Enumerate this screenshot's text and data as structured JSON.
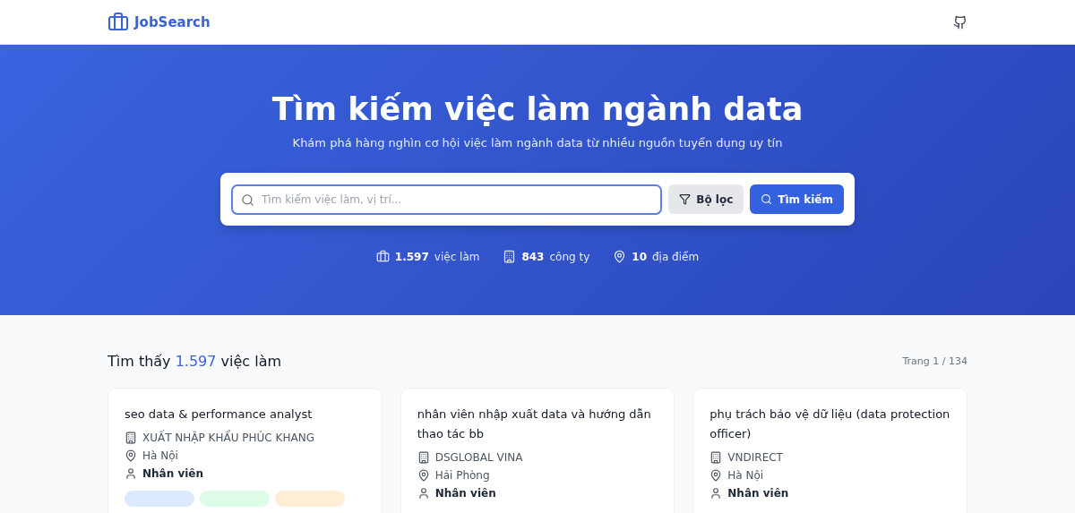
{
  "header": {
    "logo": "JobSearch"
  },
  "hero": {
    "title": "Tìm kiếm việc làm ngành data",
    "subtitle": "Khám phá hàng nghìn cơ hội việc làm ngành data từ nhiều nguồn tuyển dụng uy tín"
  },
  "search": {
    "placeholder": "Tìm kiếm việc làm, vị trí...",
    "filter_button": "Bộ lọc",
    "search_button": "Tìm kiếm"
  },
  "stats": [
    {
      "kind": "jobs",
      "value": "1.597",
      "label": "việc làm"
    },
    {
      "kind": "companies",
      "value": "843",
      "label": "công ty"
    },
    {
      "kind": "locations",
      "value": "10",
      "label": "địa điểm"
    }
  ],
  "results": {
    "prefix": "Tìm thấy",
    "count": "1.597",
    "suffix": "việc làm",
    "page": "Trang 1 / 134"
  },
  "jobs": [
    {
      "title": "seo data & performance analyst",
      "company": "XUẤT NHẬP KHẨU PHÚC KHANG",
      "location": "Hà Nội",
      "level": "Nhân viên",
      "tags": [
        {
          "color": "#dbeafe"
        },
        {
          "color": "#dcfce7"
        },
        {
          "color": "#ffedd5"
        }
      ]
    },
    {
      "title": "nhân viên nhập xuất data và hướng dẫn thao tác bb",
      "company": "DSGLOBAL VINA",
      "location": "Hải Phòng",
      "level": "Nhân viên"
    },
    {
      "title": "phụ trách bảo vệ dữ liệu (data protection officer)",
      "company": "VNDIRECT",
      "location": "Hà Nội",
      "level": "Nhân viên"
    }
  ]
}
